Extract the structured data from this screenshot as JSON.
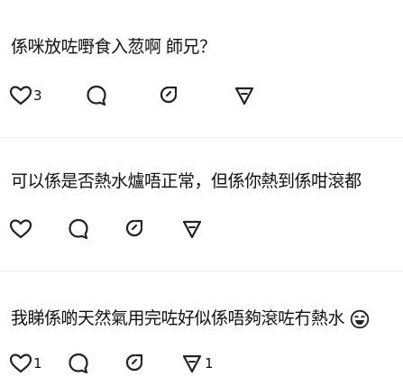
{
  "comments": [
    {
      "text": "係咪放咗嘢食入䓤啊 師兄？",
      "like_count": "3",
      "dislike_count": "",
      "has_emoji": false
    },
    {
      "text": "可以係是否熱水爐唔正常，但係你熱到係咁滾都",
      "like_count": "",
      "dislike_count": "",
      "has_emoji": false
    },
    {
      "text": "我睇係啲天然氣用完咗好似係唔夠滾咗冇熱水",
      "like_count": "1",
      "dislike_count": "1",
      "has_emoji": true
    }
  ],
  "icons": {
    "like": "heart-icon",
    "reply": "comment-bubble-icon",
    "share": "share-icon",
    "dislike": "dislike-triangle-icon",
    "emoji": "grinning-sweat-emoji"
  },
  "colors": {
    "text": "#111111",
    "icon": "#222222",
    "divider": "#f0f0f0"
  }
}
